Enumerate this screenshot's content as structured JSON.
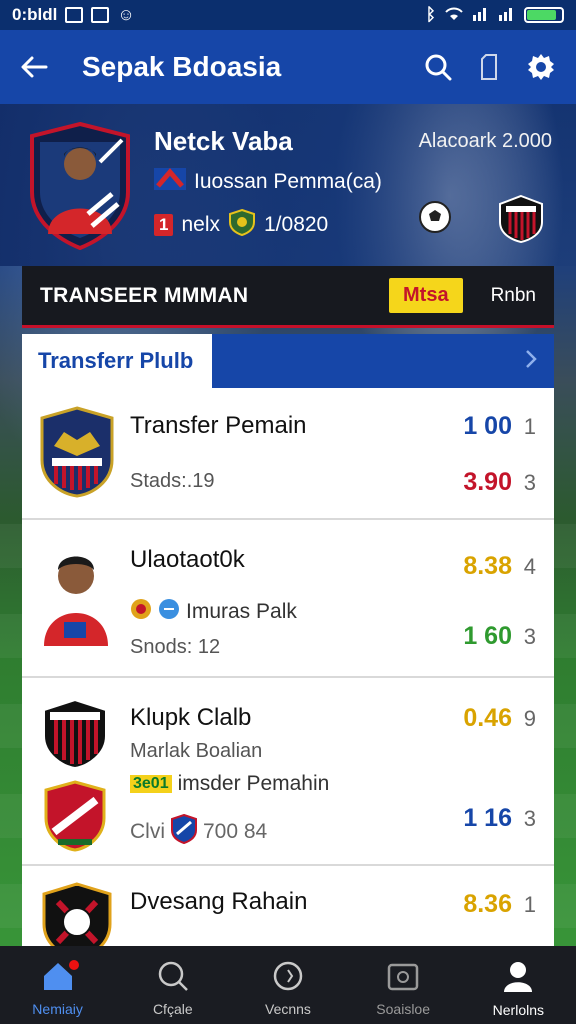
{
  "status_bar": {
    "time": "0:bldl"
  },
  "app_bar": {
    "title": "Sepak Bdoasia"
  },
  "hero": {
    "name": "Netck Vaba",
    "subtitle": "Iuossan Pemma(ca)",
    "rank_badge": "1",
    "rank_text": "nelx",
    "stat": "1/0820",
    "value": "Alacoark 2.000"
  },
  "transfer_panel": {
    "title": "TRANSEER MMMAN",
    "action_button": "Mtsa",
    "right_label": "Rnbn"
  },
  "section": {
    "tab_label": "Transferr Plulb"
  },
  "cards": [
    {
      "title": "Transfer Pemain",
      "meta": "Stads:.19",
      "values": [
        {
          "main": "1 00",
          "small": "1",
          "color": "#1646a8"
        },
        {
          "main": "3.90",
          "small": "3",
          "color": "#c3142a"
        }
      ]
    },
    {
      "title": "Ulaotaot0k",
      "line": "Imuras Palk",
      "meta": "Snods: 12",
      "values": [
        {
          "main": "8.38",
          "small": "4",
          "color": "#d9a300"
        },
        {
          "main": "1 60",
          "small": "3",
          "color": "#2f9a2f"
        }
      ]
    },
    {
      "title": "Klupk Clalb",
      "meta": "Marlak Boalian",
      "tag": "3e01",
      "line": "imsder Pemahin",
      "line2_prefix": "Clvi",
      "line2_value": "700 84",
      "values": [
        {
          "main": "0.46",
          "small": "9",
          "color": "#d9a300"
        },
        {
          "main": "1 16",
          "small": "3",
          "color": "#1646a8"
        }
      ]
    },
    {
      "title": "Dvesang Rahain",
      "values": [
        {
          "main": "8.36",
          "small": "1",
          "color": "#d9a300"
        }
      ]
    }
  ],
  "bottom_nav": [
    {
      "label": "Nemiaiy",
      "icon": "home-icon"
    },
    {
      "label": "Cfçale",
      "icon": "search-icon"
    },
    {
      "label": "Vecnns",
      "icon": "ball-icon"
    },
    {
      "label": "Soaisloe",
      "icon": "gallery-icon"
    },
    {
      "label": "Nerlolns",
      "icon": "profile-icon"
    }
  ],
  "colors": {
    "primary": "#1646a8",
    "accent_red": "#c3142a",
    "accent_yellow": "#f5d61b"
  }
}
